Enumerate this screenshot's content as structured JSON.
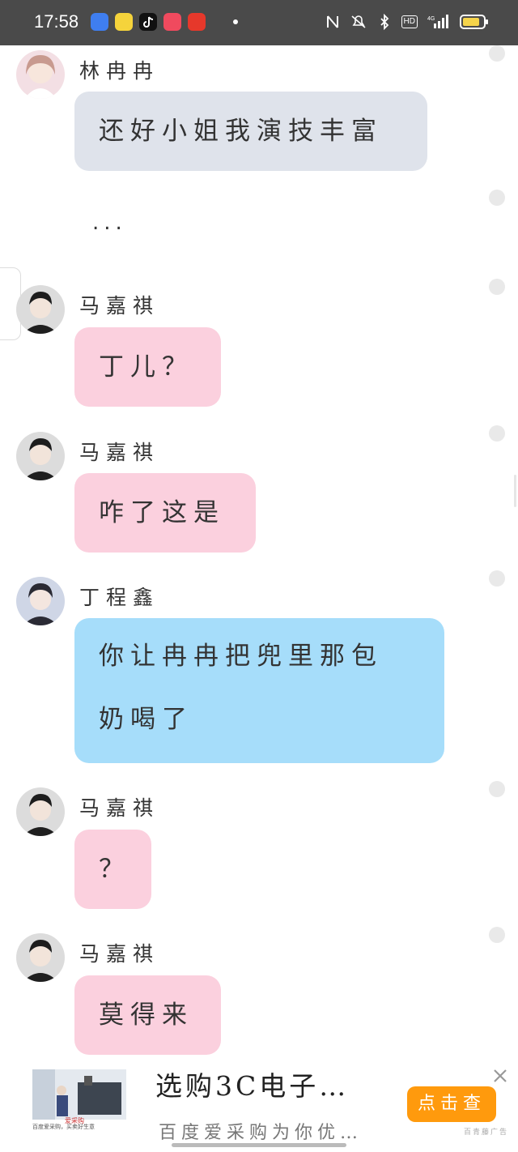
{
  "status_bar": {
    "time": "17:58",
    "app_icons": [
      "baidu-app-icon",
      "cat-app-icon",
      "tiktok-app-icon",
      "chat-app-icon",
      "weibo-app-icon"
    ],
    "indicators": [
      "nfc-icon",
      "mute-icon",
      "bluetooth-icon",
      "hd-badge",
      "4g-signal-icon",
      "battery-icon"
    ],
    "hd_label": "HD",
    "battery_level": 0.7
  },
  "messages": [
    {
      "sender": "林冉冉",
      "text": "还好小姐我演技丰富",
      "style": "gray",
      "avatar": "girl-avatar"
    },
    {
      "type": "ellipsis",
      "text": "..."
    },
    {
      "sender": "马嘉祺",
      "text": "丁儿？",
      "style": "pink",
      "avatar": "boy-avatar"
    },
    {
      "sender": "马嘉祺",
      "text": "咋了这是",
      "style": "pink",
      "avatar": "boy-avatar"
    },
    {
      "sender": "丁程鑫",
      "text_line1": "你让冉冉把兜里那包",
      "text_line2": "奶喝了",
      "style": "blue",
      "avatar": "boy-avatar-2"
    },
    {
      "sender": "马嘉祺",
      "text": "？",
      "style": "pink",
      "avatar": "boy-avatar"
    },
    {
      "sender": "马嘉祺",
      "text": "莫得来",
      "style": "pink",
      "avatar": "boy-avatar"
    }
  ],
  "ad": {
    "title": "选购3C电子…",
    "subtitle": "百度爱采购为你优…",
    "button": "点击查",
    "thumb_caption": "百度爱采购，买卖好生意",
    "thumb_logo": "爱采购",
    "source": "百青藤广告"
  },
  "colors": {
    "status_bg": "#4a4a4a",
    "bubble_gray": "#dfe3eb",
    "bubble_pink": "#fbd0de",
    "bubble_blue": "#a6ddfa",
    "ad_button": "#ff9a0d"
  }
}
